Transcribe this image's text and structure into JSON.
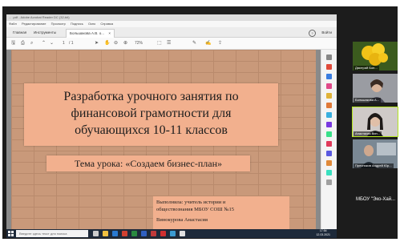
{
  "window": {
    "title": "... .pdf - Adobe Acrobat Reader DC (32-bit)",
    "menu": [
      "Файл",
      "Редактирование",
      "Просмотр",
      "Подпись",
      "Окно",
      "Справка"
    ]
  },
  "tabs": {
    "home": "Главная",
    "tools": "Инструменты",
    "document": "Большакова А.В. о...",
    "signin": "Войти",
    "help": "?"
  },
  "toolbar": {
    "page_current": "1",
    "page_total": "/ 1",
    "zoom": "72%"
  },
  "slide": {
    "title_line1": "Разработка урочного занятия по",
    "title_line2": "финансовой грамотности для",
    "title_line3": "обучающихся 10-11 классов",
    "subtitle": "Тема урока: «Создаем бизнес-план»",
    "author_line1": "Выполнила: учитель истории и",
    "author_line2": "обществознания МБОУ СОШ №15",
    "author_line3": "Винокурова Анастасия"
  },
  "taskbar": {
    "search_placeholder": "Введите здесь текст для поиска",
    "time": "17:54",
    "date": "12.03.2021"
  },
  "participants": [
    {
      "name": "Дмитрий Бон..."
    },
    {
      "name": "Большакова А..."
    },
    {
      "name": "Анастасия Вин..."
    },
    {
      "name": "Пресняков Андрей Юр..."
    }
  ],
  "bottom_label": "МБОУ \"Эко-Хай..."
}
